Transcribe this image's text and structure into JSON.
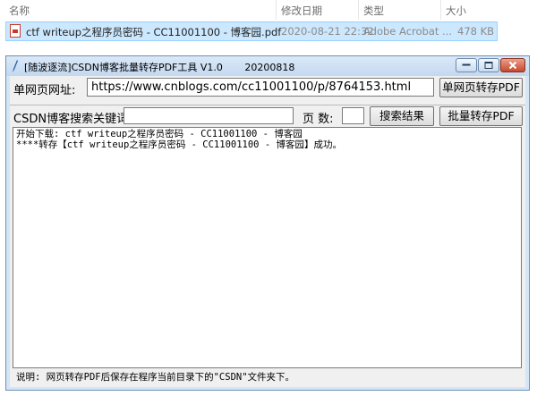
{
  "explorer": {
    "columns": [
      "名称",
      "修改日期",
      "类型",
      "大小"
    ],
    "file": {
      "name": "ctf writeup之程序员密码 - CC11001100 - 博客园.pdf",
      "modified": "2020-08-21 22:32",
      "type": "Adobe Acrobat ...",
      "size": "478 KB"
    }
  },
  "window": {
    "title": "[随波逐流]CSDN博客批量转存PDF工具 V1.0",
    "version_date": "20200818",
    "controls": [
      "minimize",
      "maximize",
      "close"
    ]
  },
  "form": {
    "url_label": "单网页网址:",
    "url_value": "https://www.cnblogs.com/cc11001100/p/8764153.html",
    "single_convert_button": "单网页转存PDF",
    "keyword_label": "CSDN博客搜索关键词:",
    "keyword_value": "",
    "pages_label": "页  数:",
    "pages_value": "",
    "search_button": "搜索结果",
    "batch_button": "批量转存PDF"
  },
  "log": {
    "lines": [
      "开始下载: ctf writeup之程序员密码 - CC11001100 - 博客园",
      "****转存【ctf writeup之程序员密码 - CC11001100 - 博客园】成功。"
    ]
  },
  "status": {
    "text": "说明: 网页转存PDF后保存在程序当前目录下的\"CSDN\"文件夹下。"
  },
  "colors": {
    "selection": "#cce8ff",
    "window_frame": "#d4e5f7",
    "close_button": "#c9482c"
  }
}
